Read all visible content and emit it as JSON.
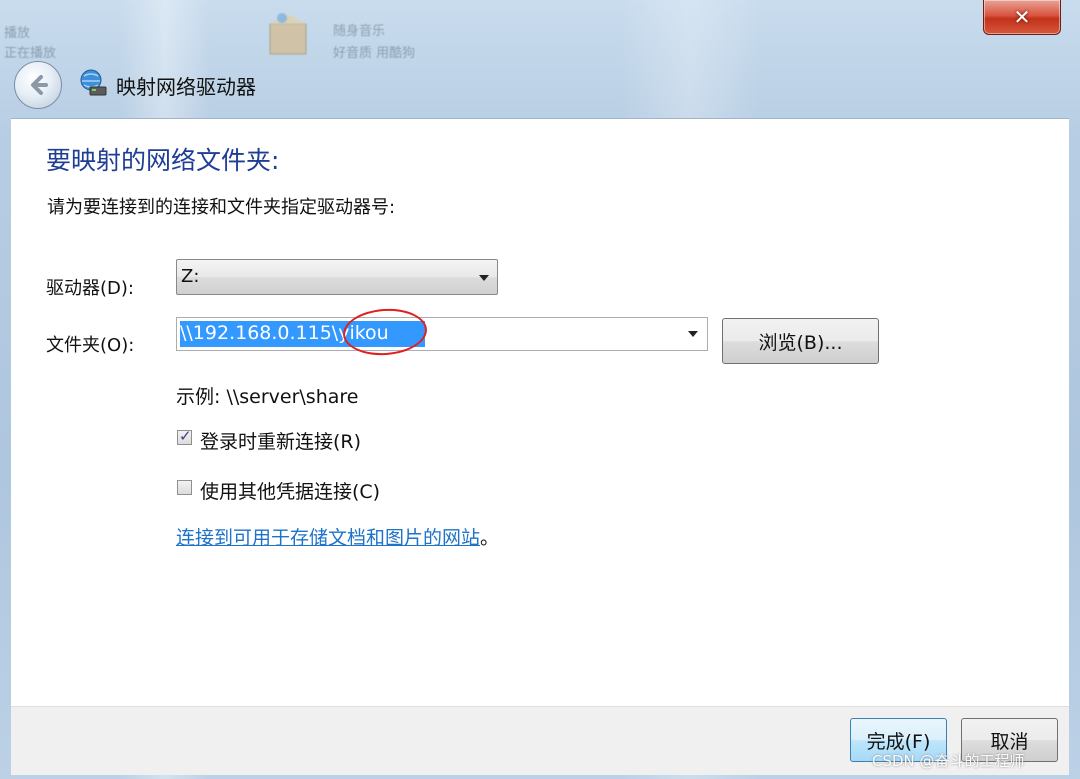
{
  "window": {
    "close_symbol": "✕",
    "background_items": [
      "随身音乐",
      "好音质 用酷狗",
      "播放",
      "正在播放"
    ]
  },
  "nav": {
    "title": "映射网络驱动器",
    "back_icon": "back-arrow-icon",
    "app_icon": "network-drive-icon"
  },
  "main": {
    "heading": "要映射的网络文件夹:",
    "instruction": "请为要连接到的连接和文件夹指定驱动器号:",
    "drive": {
      "label": "驱动器(D):",
      "value": "Z:"
    },
    "folder": {
      "label": "文件夹(O):",
      "value": "\\\\192.168.0.115\\yikou",
      "browse_label": "浏览(B)..."
    },
    "example": "示例: \\\\server\\share",
    "reconnect": {
      "label": "登录时重新连接(R)",
      "checked": true
    },
    "other_credentials": {
      "label": "使用其他凭据连接(C)",
      "checked": false
    },
    "link_text": "连接到可用于存储文档和图片的网站",
    "link_suffix": "。"
  },
  "footer": {
    "finish_label": "完成(F)",
    "cancel_label": "取消"
  },
  "watermark": "CSDN @奋斗的工程师",
  "colors": {
    "heading": "#1e3e96",
    "link": "#1e73c8",
    "selection": "#3399ff",
    "annotation": "#e02020",
    "close_button": "#c2321b"
  }
}
